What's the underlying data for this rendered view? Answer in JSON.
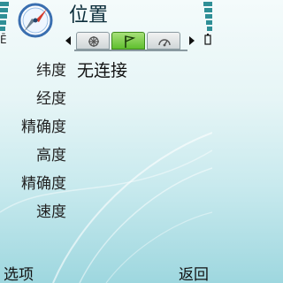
{
  "app": {
    "title": "位置",
    "icon": "compass-icon"
  },
  "status": {
    "signal_label": "Ē",
    "signal_icon": "signal-strength-icon",
    "battery_icon": "battery-icon"
  },
  "tabs": [
    {
      "icon": "satellite-icon",
      "active": false
    },
    {
      "icon": "flag-icon",
      "active": true
    },
    {
      "icon": "gauge-icon",
      "active": false
    }
  ],
  "fields": [
    {
      "label": "纬度",
      "value": "无连接"
    },
    {
      "label": "经度",
      "value": ""
    },
    {
      "label": "精确度",
      "value": ""
    },
    {
      "label": "高度",
      "value": ""
    },
    {
      "label": "精确度",
      "value": ""
    },
    {
      "label": "速度",
      "value": ""
    }
  ],
  "softkeys": {
    "left": "选项",
    "right": "返回"
  },
  "colors": {
    "active_tab": "#5fbf2e",
    "background_bottom": "#9ed7df",
    "title": "#0b2d3a"
  }
}
